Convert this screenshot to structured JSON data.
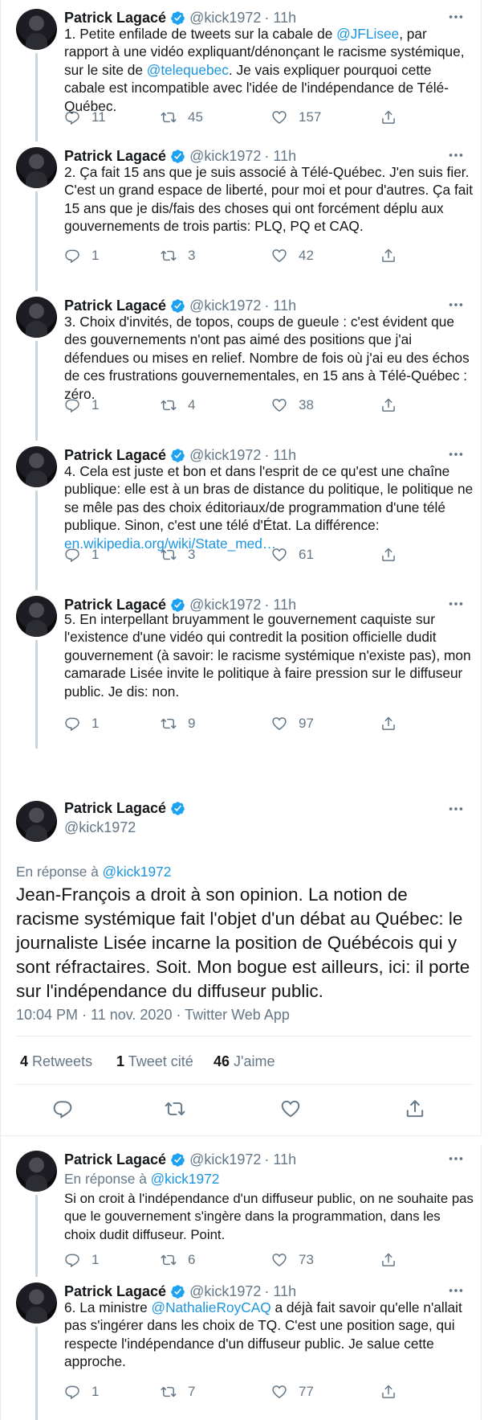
{
  "author": {
    "name": "Patrick Lagacé",
    "handle": "@kick1972",
    "time": "11h"
  },
  "tweets_top": [
    {
      "text_parts": [
        {
          "t": "1. Petite enfilade de tweets sur la cabale de "
        },
        {
          "t": "@JFLisee",
          "link": true
        },
        {
          "t": ", par rapport à une vidéo expliquant/dénonçant le racisme systémique, sur le site de "
        },
        {
          "t": "@telequebec",
          "link": true
        },
        {
          "t": ". Je vais expliquer pourquoi cette cabale est incompatible avec l'idée de l'indépendance de Télé-Québec."
        }
      ],
      "replies": "11",
      "retweets": "45",
      "likes": "157"
    },
    {
      "text_parts": [
        {
          "t": "2. Ça fait 15 ans que je suis associé à Télé-Québec. J'en suis fier. C'est un grand espace de liberté, pour moi et pour d'autres. Ça fait 15 ans que je dis/fais des choses qui ont forcément déplu aux gouvernements de trois partis: PLQ, PQ et CAQ."
        }
      ],
      "replies": "1",
      "retweets": "3",
      "likes": "42"
    },
    {
      "text_parts": [
        {
          "t": "3. Choix d'invités, de topos, coups de gueule : c'est évident que des gouvernements n'ont pas aimé des positions que j'ai défendues ou mises en relief. Nombre de fois où j'ai eu des échos de ces frustrations gouvernementales, en 15 ans à Télé-Québec : zéro."
        }
      ],
      "replies": "1",
      "retweets": "4",
      "likes": "38"
    },
    {
      "text_parts": [
        {
          "t": "4. Cela est juste et bon et dans l'esprit de ce qu'est une chaîne publique: elle est à un bras de distance du politique, le politique ne se mêle pas des choix éditoriaux/de programmation d'une télé publique. Sinon, c'est une télé d'État. La différence: "
        },
        {
          "t": "en.wikipedia.org/wiki/State_med…",
          "link": true
        }
      ],
      "replies": "1",
      "retweets": "3",
      "likes": "61"
    },
    {
      "text_parts": [
        {
          "t": "5. En interpellant bruyamment le gouvernement caquiste sur l'existence d'une vidéo qui contredit la position officielle dudit gouvernement (à savoir: le racisme systémique n'existe pas), mon camarade Lisée invite le politique à faire pression sur le diffuseur public. Je dis: non."
        }
      ],
      "replies": "1",
      "retweets": "9",
      "likes": "97"
    }
  ],
  "focused": {
    "reply_prefix": "En réponse à",
    "reply_to": "@kick1972",
    "text": "Jean-François a droit à son opinion. La notion de racisme systémique fait l'objet d'un débat au Québec: le journaliste Lisée incarne la position de Québécois qui y sont réfractaires. Soit. Mon bogue est ailleurs, ici: il porte sur l'indépendance du diffuseur public.",
    "meta": "10:04 PM · 11 nov. 2020 · Twitter Web App",
    "retweets_count": "4",
    "retweets_label": "Retweets",
    "quotes_count": "1",
    "quotes_label": "Tweet cité",
    "likes_count": "46",
    "likes_label": "J'aime"
  },
  "tweets_bottom": [
    {
      "reply_prefix": "En réponse à",
      "reply_to": "@kick1972",
      "text_parts": [
        {
          "t": "Si on croit à l'indépendance d'un diffuseur public, on ne souhaite pas que le gouvernement s'ingère dans la programmation, dans les choix dudit diffuseur. Point."
        }
      ],
      "replies": "1",
      "retweets": "6",
      "likes": "73"
    },
    {
      "text_parts": [
        {
          "t": "6. La ministre "
        },
        {
          "t": "@NathalieRoyCAQ",
          "link": true
        },
        {
          "t": " a déjà fait savoir qu'elle n'allait pas s'ingérer dans les choix de TQ. C'est une position sage, qui respecte l'indépendance d'un diffuseur public. Je salue cette approche."
        }
      ],
      "replies": "1",
      "retweets": "7",
      "likes": "77"
    }
  ],
  "icons": {
    "verified": "verified-badge-icon",
    "more": "more-icon",
    "reply": "reply-icon",
    "retweet": "retweet-icon",
    "like": "heart-icon",
    "share": "share-icon"
  },
  "colors": {
    "link": "#1b95e0",
    "verified": "#1da1f2",
    "muted": "#657786"
  }
}
